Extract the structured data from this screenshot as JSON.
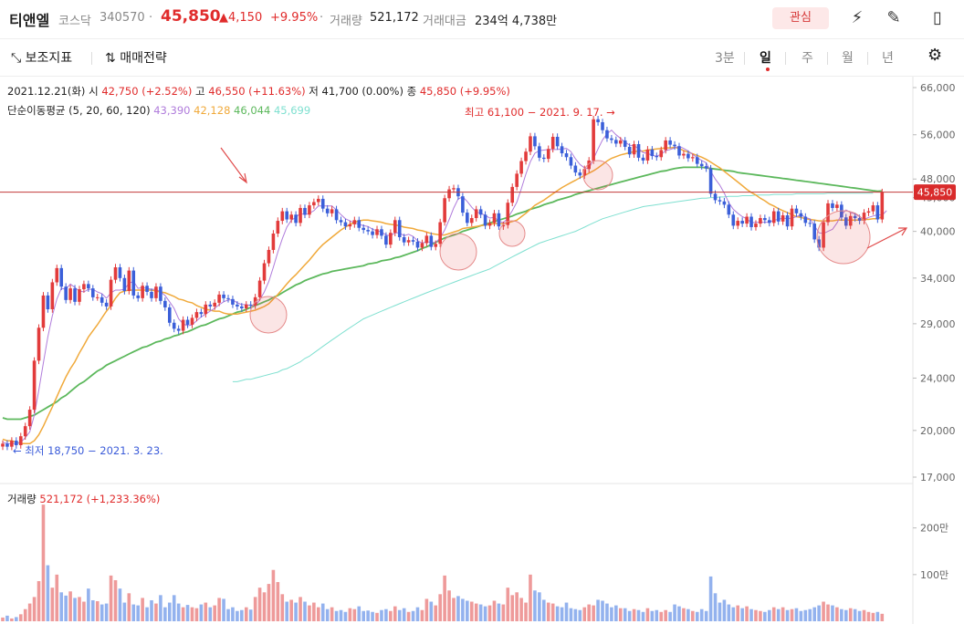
{
  "header": {
    "name": "티앤엘",
    "market": "코스닥",
    "code": "340570",
    "price": "45,850",
    "change": "▲4,150",
    "change_pct": "+9.95%",
    "volume_label": "거래량",
    "volume": "521,172",
    "amount_label": "거래대금",
    "amount": "234억 4,738만",
    "fav_label": "관심"
  },
  "toolbar": {
    "indicator_label": "보조지표",
    "strategy_label": "매매전략",
    "periods": [
      "3분",
      "일",
      "주",
      "월",
      "년"
    ],
    "active_period": "일"
  },
  "info": {
    "date": "2021.12.21(화)",
    "open_label": "시",
    "open": "42,750 (+2.52%)",
    "high_label": "고",
    "high": "46,550 (+11.63%)",
    "low_label": "저",
    "low": "41,700 (0.00%)",
    "close_label": "종",
    "close": "45,850 (+9.95%)"
  },
  "ma_legend": {
    "label": "단순이동평균 (5, 20, 60, 120)",
    "values": [
      "43,390",
      "42,128",
      "46,044",
      "45,699"
    ],
    "colors": [
      "#b07cdb",
      "#f0a93a",
      "#5cb85c",
      "#7fe0d0"
    ]
  },
  "volume_legend": {
    "label": "거래량",
    "value": "521,172 (+1,233.36%)"
  },
  "annotations": {
    "high": "최고 61,100 − 2021. 9. 17. →",
    "low": "← 최저 18,750 − 2021. 3. 23.",
    "current_price": "45,850"
  },
  "colors": {
    "up": "#e23b3b",
    "down": "#3b5fd9",
    "up_vol": "#ee9a9a",
    "down_vol": "#93b2ee"
  },
  "chart_data": {
    "type": "candlestick",
    "price_axis": {
      "ticks": [
        66000,
        56000,
        48000,
        45000,
        40000,
        34000,
        29000,
        24000,
        20000,
        17000
      ],
      "tick_labels": [
        "66,000",
        "56,000",
        "48,000",
        "45,000",
        "40,000",
        "34,000",
        "29,000",
        "24,000",
        "20,000",
        "17,000"
      ],
      "scale": "log"
    },
    "volume_axis": {
      "ticks": [
        2000000,
        1000000
      ],
      "tick_labels": [
        "200만",
        "100만"
      ]
    },
    "close": [
      19100,
      18900,
      19300,
      19000,
      19600,
      20300,
      21500,
      25500,
      28600,
      32000,
      30500,
      33500,
      35200,
      33000,
      31500,
      32800,
      31300,
      32700,
      33300,
      32800,
      31800,
      31800,
      31200,
      30800,
      33800,
      35300,
      34000,
      32500,
      34900,
      32000,
      31700,
      33100,
      32400,
      31700,
      33000,
      31400,
      30700,
      29100,
      28500,
      28300,
      29400,
      28900,
      29600,
      30200,
      30000,
      31000,
      30800,
      31200,
      32100,
      31700,
      31600,
      31000,
      30800,
      30600,
      31000,
      30900,
      31800,
      33700,
      35800,
      37500,
      39700,
      41500,
      42900,
      41700,
      42400,
      41200,
      43400,
      42400,
      43800,
      44300,
      44800,
      43300,
      42600,
      43200,
      41600,
      41300,
      40700,
      41000,
      41600,
      40500,
      40200,
      40000,
      39500,
      40300,
      39400,
      38200,
      39800,
      41600,
      39200,
      38500,
      38800,
      38600,
      37800,
      38400,
      39400,
      37900,
      38300,
      41300,
      44900,
      46300,
      46500,
      45200,
      42700,
      41200,
      41900,
      43200,
      42400,
      40800,
      41200,
      42600,
      40700,
      40900,
      44200,
      46700,
      48900,
      51100,
      52800,
      55700,
      53800,
      51700,
      51500,
      53300,
      55600,
      53800,
      52500,
      51800,
      50300,
      49100,
      48600,
      49700,
      51200,
      59100,
      58500,
      56900,
      55300,
      55000,
      54300,
      54900,
      53700,
      52300,
      54200,
      51700,
      51200,
      53200,
      52000,
      51800,
      53100,
      54900,
      54100,
      53800,
      52100,
      52400,
      51600,
      51800,
      50600,
      50200,
      49800,
      45600,
      44600,
      44400,
      43900,
      42400,
      40800,
      41500,
      41100,
      42100,
      40600,
      41100,
      41900,
      41600,
      41200,
      42900,
      41400,
      42300,
      40700,
      43300,
      42600,
      42100,
      41200,
      41100,
      38900,
      37800,
      41300,
      44100,
      43400,
      43900,
      42000,
      40800,
      42200,
      41900,
      41500,
      42700,
      42900,
      43800,
      41700,
      45850
    ],
    "ma5": [
      19200,
      19100,
      19100,
      19100,
      19200,
      19500,
      19900,
      21100,
      23000,
      25300,
      27700,
      29800,
      31600,
      32800,
      32700,
      33300,
      32900,
      32500,
      32400,
      32700,
      32700,
      32400,
      32200,
      31700,
      32300,
      32600,
      32600,
      32700,
      33400,
      33600,
      32800,
      32900,
      32800,
      32700,
      32700,
      32400,
      32000,
      31300,
      30600,
      29500,
      29000,
      28800,
      28900,
      29300,
      29700,
      30000,
      30300,
      30600,
      31000,
      31300,
      31500,
      31500,
      31200,
      31000,
      31000,
      30900,
      30900,
      31500,
      32400,
      33600,
      35300,
      37200,
      39000,
      40600,
      41600,
      42000,
      42600,
      42400,
      42600,
      43000,
      43700,
      43700,
      43700,
      43700,
      43100,
      42400,
      41800,
      41500,
      41200,
      41000,
      40800,
      40700,
      40300,
      40100,
      39900,
      39500,
      39400,
      39800,
      39800,
      39400,
      39600,
      39300,
      38700,
      38400,
      38600,
      38500,
      38500,
      39100,
      40200,
      41700,
      43400,
      44800,
      45100,
      44400,
      43500,
      42800,
      42600,
      42300,
      41900,
      42000,
      41500,
      41200,
      41900,
      43000,
      44300,
      46400,
      48800,
      51000,
      52500,
      53000,
      53100,
      53200,
      53200,
      53200,
      53300,
      53400,
      52800,
      51500,
      50500,
      49900,
      49800,
      51500,
      53300,
      55000,
      56200,
      56900,
      56000,
      55300,
      54600,
      54000,
      53900,
      53400,
      52600,
      52500,
      52100,
      52000,
      52300,
      53000,
      53200,
      53500,
      53800,
      53400,
      52900,
      52300,
      51700,
      51200,
      50800,
      49300,
      48000,
      47000,
      45700,
      44200,
      43200,
      42600,
      42100,
      41800,
      41200,
      41300,
      41300,
      41300,
      41300,
      41600,
      41700,
      41900,
      41800,
      41900,
      42100,
      42400,
      42000,
      41800,
      40800,
      39800,
      39700,
      40000,
      40300,
      41200,
      42400,
      43100,
      42700,
      42500,
      42100,
      41700,
      42000,
      42200,
      42400,
      42300,
      43000
    ],
    "ma20": [
      19400,
      19300,
      19300,
      19200,
      19100,
      19100,
      19100,
      19300,
      19700,
      20300,
      21000,
      21700,
      22500,
      23300,
      24100,
      24800,
      25400,
      26200,
      26900,
      27700,
      28300,
      28900,
      29600,
      30300,
      30900,
      31700,
      32300,
      32500,
      32600,
      32600,
      32600,
      32600,
      32600,
      32600,
      32500,
      32400,
      32300,
      32100,
      31900,
      31600,
      31500,
      31300,
      31200,
      30900,
      30700,
      30500,
      30400,
      30300,
      30300,
      30100,
      30000,
      30000,
      30000,
      30100,
      30200,
      30300,
      30400,
      30600,
      30800,
      31100,
      31600,
      32100,
      32700,
      33300,
      33900,
      34400,
      35000,
      35600,
      36200,
      36900,
      37600,
      38200,
      38700,
      39200,
      39700,
      40200,
      40600,
      41000,
      41300,
      41500,
      41600,
      41600,
      41500,
      41400,
      41300,
      41100,
      41000,
      40900,
      40800,
      40600,
      40500,
      40400,
      40200,
      40100,
      39900,
      39700,
      39600,
      39500,
      39500,
      39700,
      39900,
      40100,
      40400,
      40500,
      40600,
      40700,
      40800,
      40900,
      41000,
      41100,
      41100,
      41100,
      41200,
      41400,
      41600,
      42100,
      42600,
      43200,
      43800,
      44200,
      44600,
      45100,
      45600,
      46100,
      46600,
      47000,
      47400,
      47800,
      48200,
      48600,
      49000,
      49400,
      49900,
      50500,
      51100,
      51600,
      51900,
      52200,
      52400,
      52600,
      52800,
      52900,
      52900,
      53100,
      53200,
      53300,
      53400,
      53500,
      53500,
      53600,
      53400,
      53000,
      52700,
      52400,
      52100,
      51800,
      51400,
      50900,
      50400,
      49900,
      49300,
      48700,
      48100,
      47500,
      46900,
      46300,
      45800,
      45400,
      44900,
      44500,
      44000,
      43700,
      43300,
      43000,
      42700,
      42400,
      42100,
      42000,
      41800,
      41700,
      41600,
      41500,
      41500,
      41500,
      41500,
      41600,
      41600,
      41600,
      41600,
      41600,
      41600,
      41700,
      41700,
      41800,
      41800,
      42128
    ],
    "ma60": [
      20900,
      20800,
      20800,
      20800,
      20800,
      20900,
      21000,
      21100,
      21300,
      21500,
      21700,
      21900,
      22100,
      22400,
      22600,
      22900,
      23200,
      23500,
      23700,
      24000,
      24300,
      24600,
      24800,
      25100,
      25300,
      25500,
      25700,
      25900,
      26100,
      26300,
      26500,
      26700,
      26800,
      27000,
      27200,
      27300,
      27500,
      27600,
      27800,
      27900,
      28100,
      28200,
      28400,
      28600,
      28800,
      28900,
      29100,
      29300,
      29500,
      29600,
      29800,
      30000,
      30200,
      30300,
      30500,
      30700,
      30900,
      31100,
      31300,
      31500,
      31800,
      32000,
      32300,
      32600,
      32900,
      33200,
      33400,
      33700,
      33900,
      34100,
      34300,
      34500,
      34600,
      34800,
      34900,
      35000,
      35100,
      35200,
      35300,
      35400,
      35500,
      35700,
      35800,
      35900,
      36100,
      36200,
      36300,
      36500,
      36600,
      36800,
      37000,
      37200,
      37400,
      37700,
      37900,
      38200,
      38500,
      38800,
      39100,
      39300,
      39500,
      39700,
      40000,
      40200,
      40400,
      40600,
      40800,
      41000,
      41200,
      41400,
      41600,
      41800,
      42000,
      42200,
      42500,
      42700,
      42900,
      43200,
      43400,
      43600,
      43900,
      44100,
      44300,
      44600,
      44800,
      45000,
      45200,
      45500,
      45700,
      45900,
      46100,
      46300,
      46500,
      46700,
      46900,
      47100,
      47300,
      47500,
      47700,
      47900,
      48100,
      48300,
      48500,
      48700,
      48900,
      49100,
      49300,
      49400,
      49600,
      49800,
      49900,
      50000,
      50000,
      50000,
      50000,
      50000,
      49900,
      49800,
      49700,
      49600,
      49500,
      49400,
      49300,
      49100,
      49000,
      48900,
      48800,
      48700,
      48600,
      48500,
      48400,
      48300,
      48200,
      48100,
      48000,
      47900,
      47800,
      47700,
      47600,
      47500,
      47400,
      47300,
      47200,
      47100,
      47000,
      46900,
      46800,
      46700,
      46600,
      46500,
      46400,
      46300,
      46200,
      46100,
      46000,
      46044
    ],
    "ma120": [
      null,
      null,
      null,
      null,
      null,
      null,
      null,
      null,
      null,
      null,
      null,
      null,
      null,
      null,
      null,
      null,
      null,
      null,
      null,
      null,
      null,
      null,
      null,
      null,
      null,
      null,
      null,
      null,
      null,
      null,
      null,
      null,
      null,
      null,
      null,
      null,
      null,
      null,
      null,
      null,
      null,
      null,
      null,
      null,
      null,
      null,
      null,
      null,
      null,
      null,
      null,
      23700,
      23700,
      23800,
      23900,
      23900,
      24000,
      24100,
      24200,
      24300,
      24400,
      24500,
      24700,
      24800,
      25000,
      25200,
      25400,
      25700,
      25900,
      26200,
      26500,
      26800,
      27100,
      27400,
      27700,
      28000,
      28300,
      28600,
      28900,
      29200,
      29500,
      29700,
      29900,
      30100,
      30300,
      30500,
      30700,
      30900,
      31100,
      31300,
      31500,
      31700,
      31900,
      32100,
      32300,
      32500,
      32700,
      32900,
      33100,
      33300,
      33500,
      33700,
      33900,
      34100,
      34300,
      34500,
      34700,
      34900,
      35100,
      35400,
      35700,
      36000,
      36300,
      36600,
      36900,
      37200,
      37500,
      37800,
      38100,
      38400,
      38600,
      38800,
      39000,
      39200,
      39400,
      39600,
      39800,
      40000,
      40300,
      40600,
      40900,
      41200,
      41500,
      41800,
      42000,
      42200,
      42400,
      42600,
      42800,
      43000,
      43200,
      43400,
      43600,
      43700,
      43800,
      43900,
      44000,
      44100,
      44200,
      44300,
      44400,
      44500,
      44600,
      44700,
      44800,
      44900,
      44900,
      45000,
      45000,
      45100,
      45100,
      45200,
      45200,
      45200,
      45300,
      45300,
      45300,
      45400,
      45400,
      45400,
      45400,
      45500,
      45500,
      45500,
      45500,
      45500,
      45600,
      45600,
      45600,
      45600,
      45600,
      45600,
      45600,
      45700,
      45700,
      45700,
      45700,
      45700,
      45700,
      45700,
      45700,
      45700,
      45700,
      45699
    ],
    "volume": [
      80000,
      120000,
      60000,
      90000,
      150000,
      260000,
      380000,
      520000,
      860000,
      2500000,
      1200000,
      720000,
      1000000,
      620000,
      550000,
      640000,
      500000,
      520000,
      420000,
      700000,
      450000,
      430000,
      360000,
      380000,
      980000,
      880000,
      700000,
      400000,
      600000,
      360000,
      340000,
      500000,
      300000,
      450000,
      380000,
      560000,
      300000,
      400000,
      560000,
      380000,
      300000,
      350000,
      300000,
      280000,
      360000,
      400000,
      300000,
      340000,
      500000,
      480000,
      260000,
      300000,
      220000,
      240000,
      300000,
      250000,
      520000,
      720000,
      620000,
      800000,
      1100000,
      840000,
      580000,
      420000,
      460000,
      400000,
      520000,
      420000,
      340000,
      400000,
      300000,
      380000,
      260000,
      300000,
      220000,
      240000,
      200000,
      280000,
      260000,
      320000,
      220000,
      230000,
      200000,
      180000,
      240000,
      260000,
      220000,
      320000,
      240000,
      280000,
      200000,
      220000,
      300000,
      240000,
      480000,
      420000,
      340000,
      580000,
      980000,
      660000,
      500000,
      540000,
      480000,
      440000,
      420000,
      380000,
      360000,
      320000,
      340000,
      440000,
      380000,
      360000,
      720000,
      560000,
      620000,
      500000,
      400000,
      1000000,
      660000,
      620000,
      460000,
      400000,
      380000,
      320000,
      300000,
      400000,
      280000,
      260000,
      240000,
      300000,
      360000,
      340000,
      460000,
      440000,
      380000,
      300000,
      340000,
      280000,
      280000,
      220000,
      260000,
      240000,
      200000,
      280000,
      220000,
      240000,
      200000,
      240000,
      200000,
      360000,
      320000,
      280000,
      260000,
      220000,
      200000,
      260000,
      220000,
      960000,
      600000,
      400000,
      460000,
      360000,
      300000,
      340000,
      280000,
      320000,
      260000,
      240000,
      220000,
      200000,
      240000,
      300000,
      260000,
      300000,
      240000,
      260000,
      280000,
      220000,
      240000,
      260000,
      300000,
      340000,
      420000,
      360000,
      340000,
      300000,
      260000,
      240000,
      280000,
      260000,
      220000,
      240000,
      200000,
      180000,
      200000,
      160000,
      521172
    ]
  }
}
